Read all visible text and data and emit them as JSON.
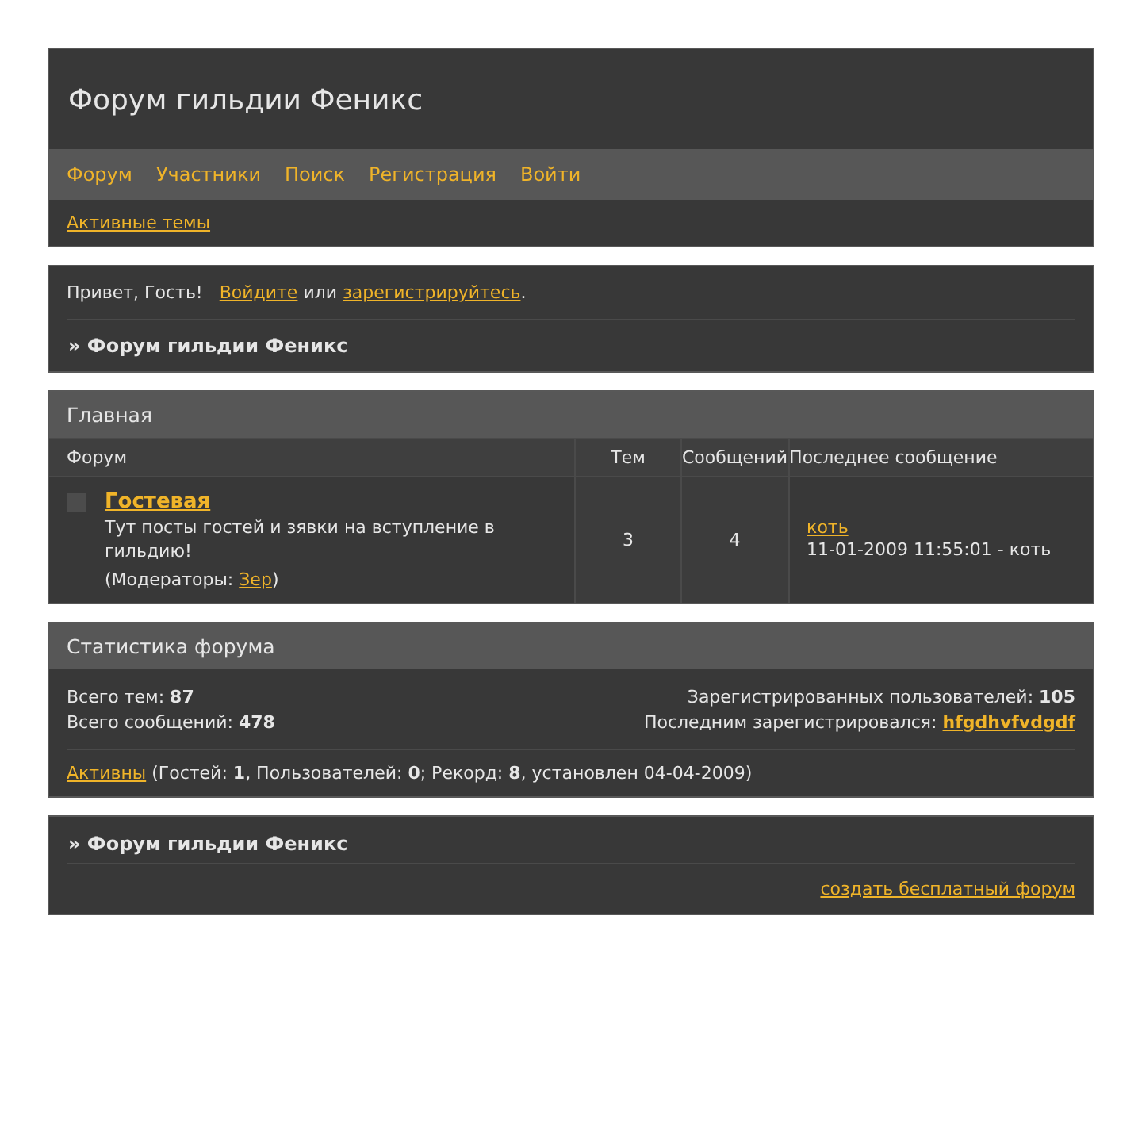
{
  "site_title": "Форум гильдии Феникс",
  "nav": [
    "Форум",
    "Участники",
    "Поиск",
    "Регистрация",
    "Войти"
  ],
  "sub_link": "Активные темы",
  "welcome": {
    "greeting": "Привет, Гость!",
    "login_link": "Войдите",
    "or": "или",
    "register_link": "зарегистрируйтесь",
    "end": "."
  },
  "breadcrumb": "» Форум гильдии Феникс",
  "category": {
    "title": "Главная",
    "columns": [
      "Форум",
      "Тем",
      "Сообщений",
      "Последнее сообщение"
    ],
    "rows": [
      {
        "name": "Гостевая",
        "description": "Тут посты гостей и зявки на вступление в гильдию!",
        "moderators_label": "(Модераторы: ",
        "moderator": "Зер",
        "moderators_end": ")",
        "topics": "3",
        "posts": "4",
        "last_topic": "коть",
        "last_info": "11-01-2009 11:55:01 - коть"
      }
    ]
  },
  "stats": {
    "title": "Статистика форума",
    "total_topics": "Всего тем: **87**",
    "total_posts": "Всего сообщений: **478**",
    "registered": "Зарегистрированных пользователей: **105**",
    "last_registered_label": "Последним зарегистрировался:",
    "last_registered": "hfgdhvfvdgdf",
    "online_link": "Активны",
    "online_text": "(Гостей: **1**, Пользователей: **0**; Рекорд: **8**, установлен 04-04-2009)"
  },
  "footer": {
    "breadcrumb": "» Форум гильдии Феникс",
    "link": "создать бесплатный форум"
  }
}
